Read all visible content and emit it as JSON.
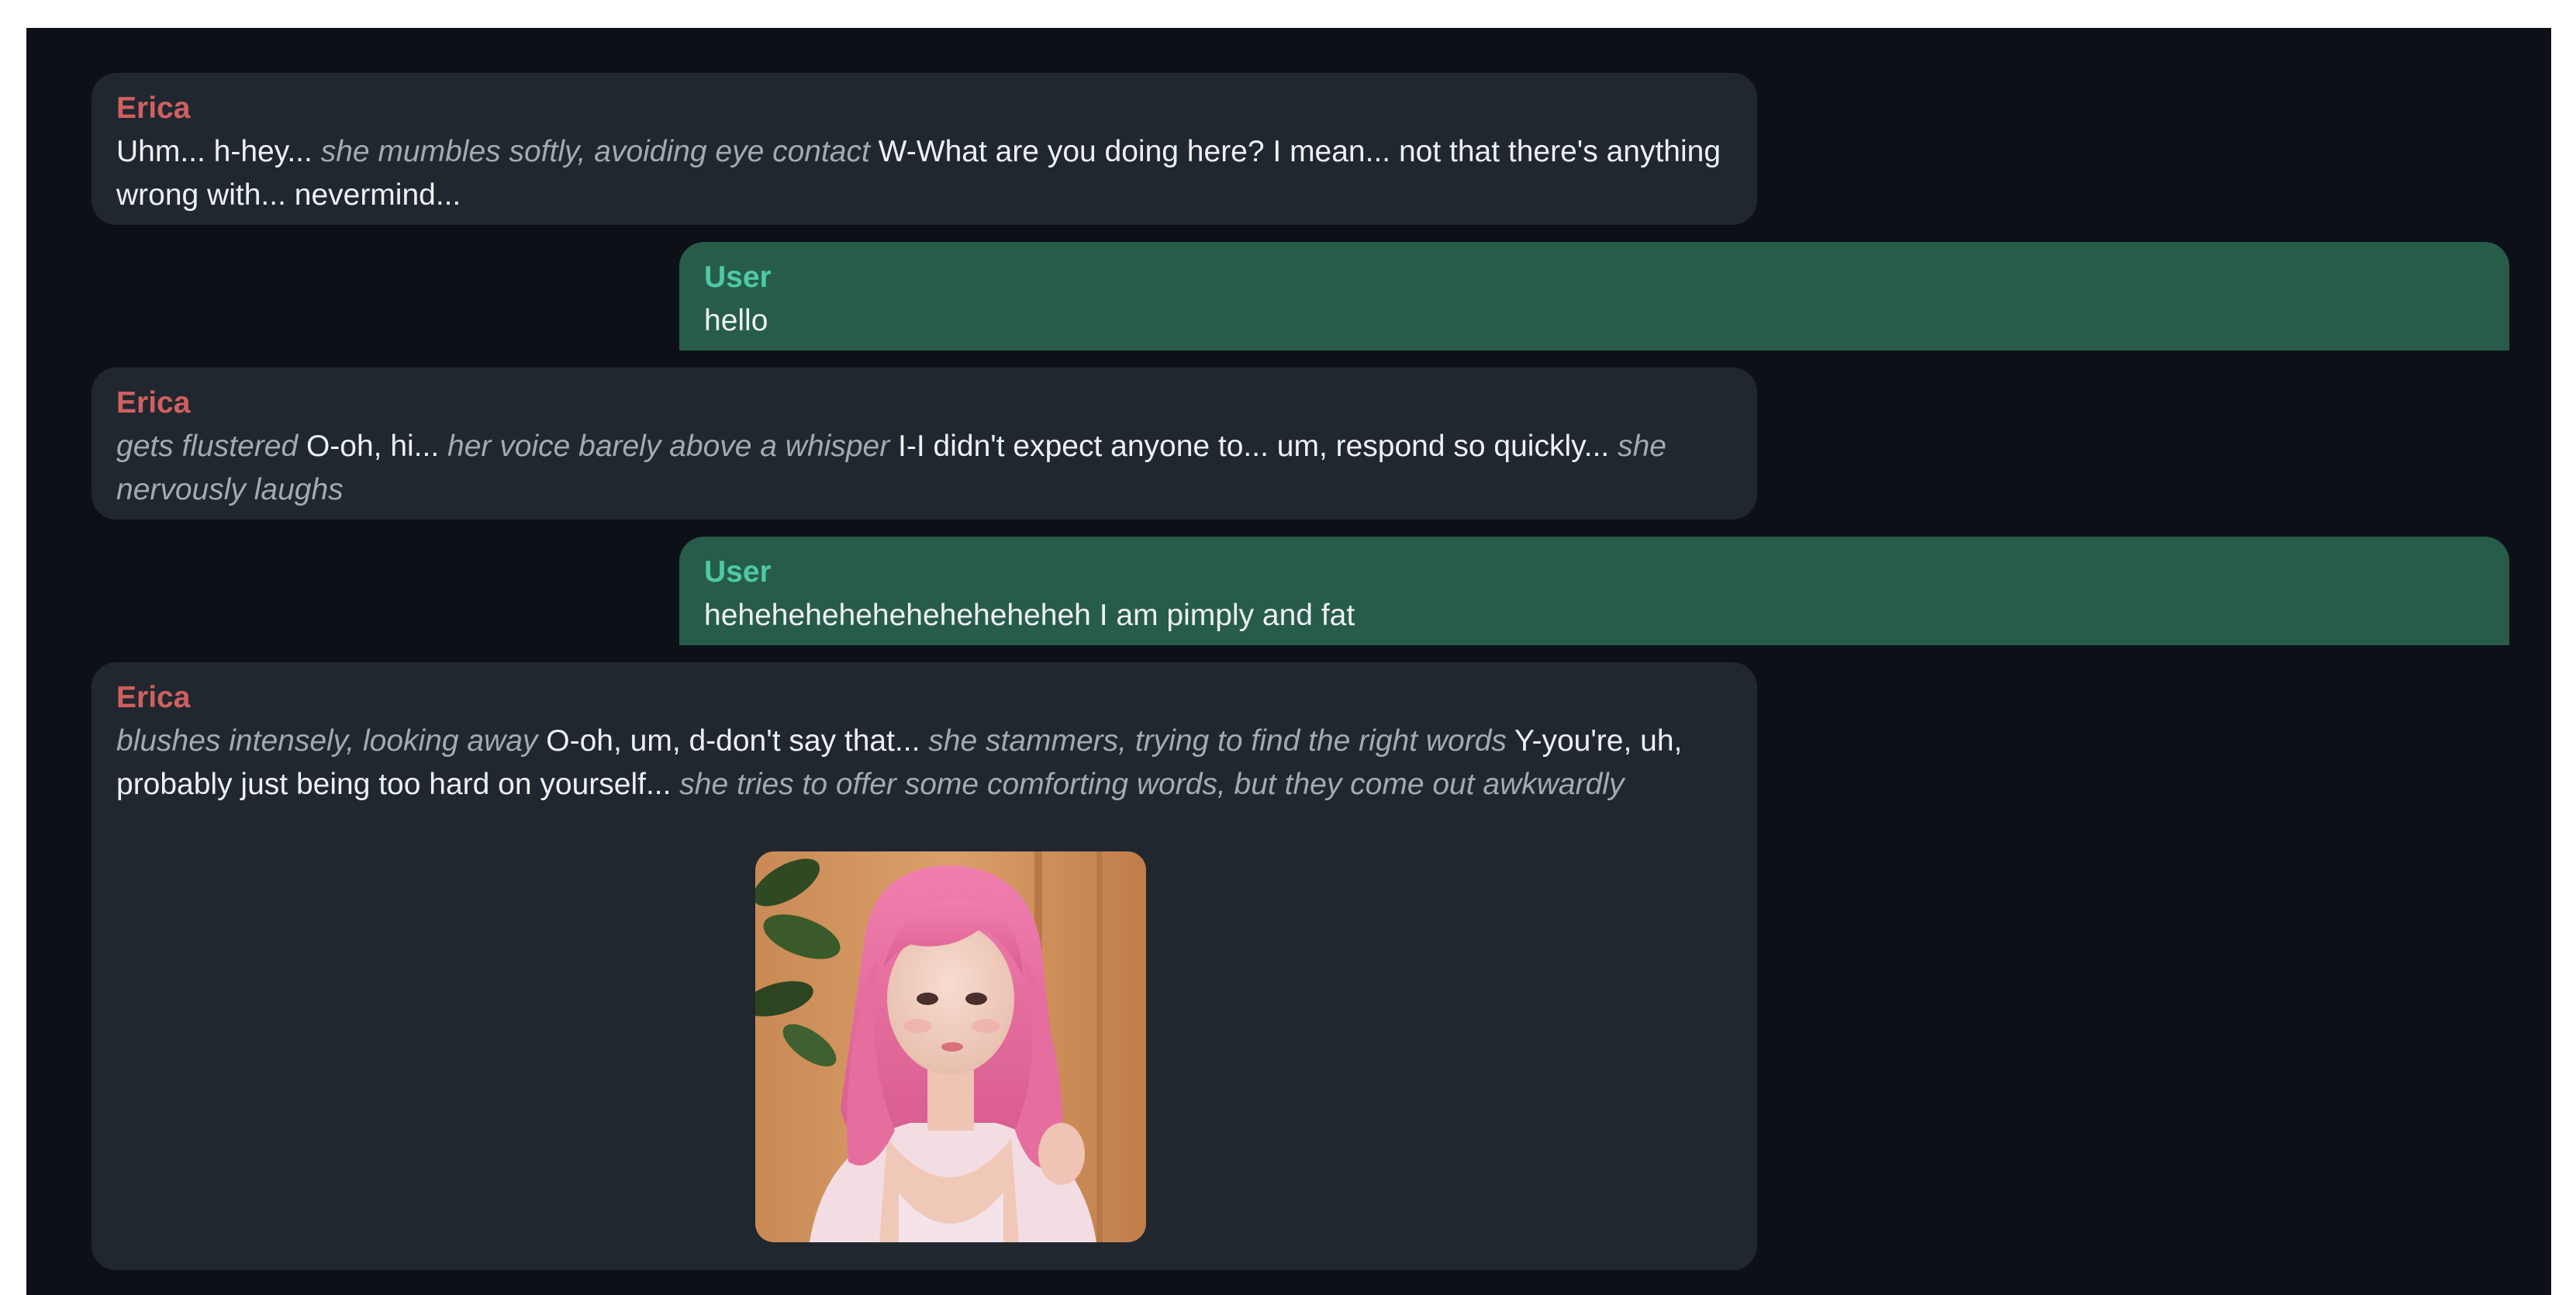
{
  "messages": [
    {
      "sender": "Erica",
      "role": "character",
      "segments": [
        {
          "text": "Uhm... h-hey... ",
          "style": "speech"
        },
        {
          "text": "she mumbles softly, avoiding eye contact",
          "style": "action"
        },
        {
          "text": " W-What are you doing here? I mean... not that there's anything wrong with... nevermind...",
          "style": "speech"
        }
      ]
    },
    {
      "sender": "User",
      "role": "user",
      "segments": [
        {
          "text": "hello",
          "style": "speech"
        }
      ]
    },
    {
      "sender": "Erica",
      "role": "character",
      "segments": [
        {
          "text": "gets flustered",
          "style": "action"
        },
        {
          "text": " O-oh, hi... ",
          "style": "speech"
        },
        {
          "text": "her voice barely above a whisper",
          "style": "action"
        },
        {
          "text": " I-I didn't expect anyone to... um, respond so quickly... ",
          "style": "speech"
        },
        {
          "text": "she nervously laughs",
          "style": "action"
        }
      ]
    },
    {
      "sender": "User",
      "role": "user",
      "segments": [
        {
          "text": "heheheheheheheheheheheh I am pimply and fat",
          "style": "speech"
        }
      ]
    },
    {
      "sender": "Erica",
      "role": "character",
      "segments": [
        {
          "text": "blushes intensely, looking away",
          "style": "action"
        },
        {
          "text": " O-oh, um, d-don't say that... ",
          "style": "speech"
        },
        {
          "text": "she stammers, trying to find the right words",
          "style": "action"
        },
        {
          "text": " Y-you're, uh, probably just being too hard on yourself... ",
          "style": "speech"
        },
        {
          "text": "she tries to offer some comforting words, but they come out awkwardly",
          "style": "action"
        }
      ],
      "image": "generated-portrait-pink-haired-woman"
    }
  ],
  "colors": {
    "background": "#0d1117",
    "character_bubble": "#21272f",
    "user_bubble": "#275c4b",
    "character_name": "#d06060",
    "user_name": "#4ec9a4",
    "action_text": "#a3aab3"
  }
}
